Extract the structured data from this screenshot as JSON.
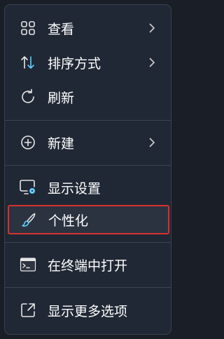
{
  "menu": {
    "items": [
      {
        "label": "查看",
        "icon": "view-grid-icon",
        "has_submenu": true
      },
      {
        "label": "排序方式",
        "icon": "sort-arrows-icon",
        "has_submenu": true
      },
      {
        "label": "刷新",
        "icon": "refresh-icon",
        "has_submenu": false
      },
      {
        "label": "新建",
        "icon": "new-plus-icon",
        "has_submenu": true
      },
      {
        "label": "显示设置",
        "icon": "display-settings-icon",
        "has_submenu": false
      },
      {
        "label": "个性化",
        "icon": "personalize-brush-icon",
        "has_submenu": false,
        "highlighted": true
      },
      {
        "label": "在终端中打开",
        "icon": "terminal-icon",
        "has_submenu": false
      },
      {
        "label": "显示更多选项",
        "icon": "more-options-icon",
        "has_submenu": false
      }
    ]
  },
  "colors": {
    "menu_bg": "#212835",
    "text": "#ffffff",
    "highlight_border": "#d9302c",
    "accent": "#60cdff"
  }
}
